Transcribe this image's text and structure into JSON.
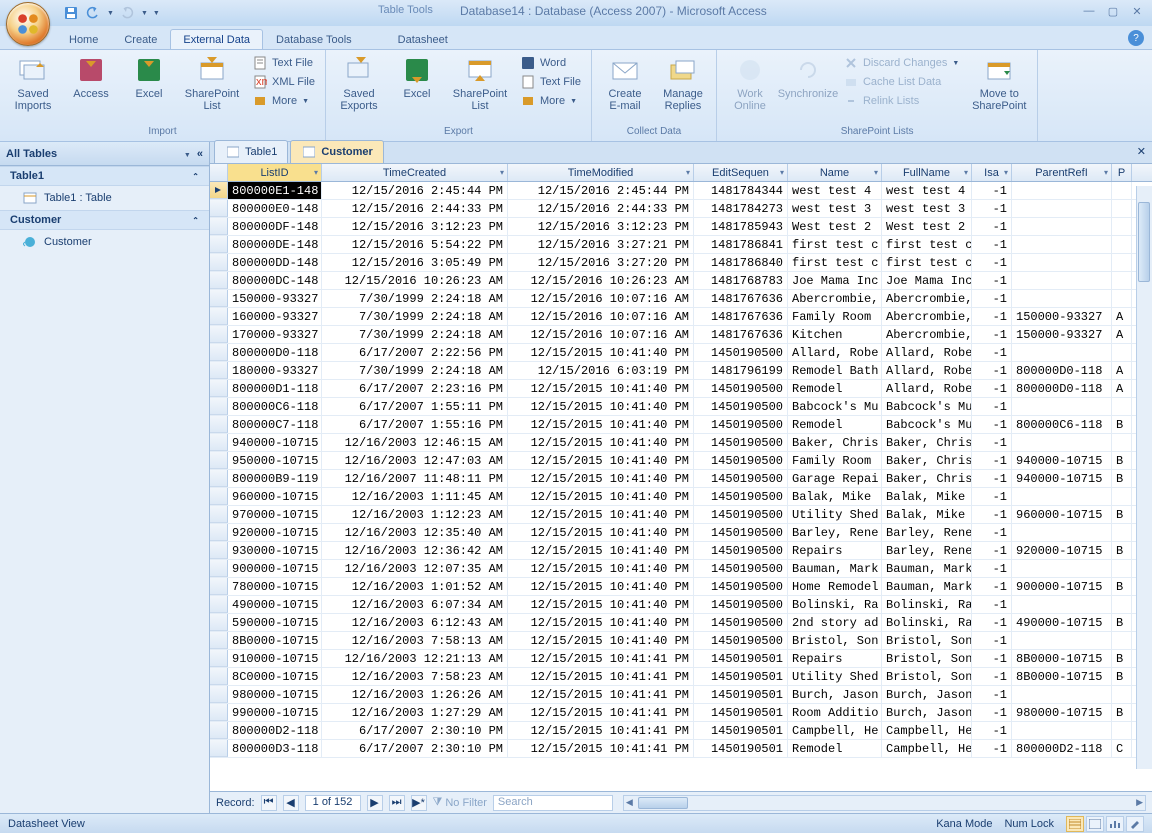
{
  "title_context": "Table Tools",
  "title_main": "Database14 : Database (Access 2007) - Microsoft Access",
  "tabs": [
    "Home",
    "Create",
    "External Data",
    "Database Tools",
    "Datasheet"
  ],
  "active_tab": "External Data",
  "ribbon": {
    "import": {
      "label": "Import",
      "saved_imports": "Saved Imports",
      "access": "Access",
      "excel": "Excel",
      "sp_list": "SharePoint List",
      "text_file": "Text File",
      "xml_file": "XML File",
      "more": "More"
    },
    "export": {
      "label": "Export",
      "saved_exports": "Saved Exports",
      "excel": "Excel",
      "sp_list": "SharePoint List",
      "word": "Word",
      "text_file": "Text File",
      "more": "More"
    },
    "collect": {
      "label": "Collect Data",
      "create_email": "Create E-mail",
      "manage_replies": "Manage Replies"
    },
    "sp": {
      "label": "SharePoint Lists",
      "work_online": "Work Online",
      "synchronize": "Synchronize",
      "discard": "Discard Changes",
      "cache": "Cache List Data",
      "relink": "Relink Lists",
      "move": "Move to SharePoint"
    }
  },
  "nav": {
    "header": "All Tables",
    "groups": [
      {
        "title": "Table1",
        "items": [
          "Table1 : Table"
        ]
      },
      {
        "title": "Customer",
        "items": [
          "Customer"
        ]
      }
    ]
  },
  "doc_tabs": [
    "Table1",
    "Customer"
  ],
  "active_doc": "Customer",
  "columns": [
    "ListID",
    "TimeCreated",
    "TimeModified",
    "EditSequen",
    "Name",
    "FullName",
    "Isa",
    "ParentRefI",
    "P"
  ],
  "rows": [
    [
      "800000E1-148",
      "12/15/2016 2:45:44 PM",
      "12/15/2016 2:45:44 PM",
      "1481784344",
      "west test 4",
      "west test 4",
      "-1",
      "",
      ""
    ],
    [
      "800000E0-148",
      "12/15/2016 2:44:33 PM",
      "12/15/2016 2:44:33 PM",
      "1481784273",
      "west test 3",
      "west test 3",
      "-1",
      "",
      ""
    ],
    [
      "800000DF-148",
      "12/15/2016 3:12:23 PM",
      "12/15/2016 3:12:23 PM",
      "1481785943",
      "West test 2",
      "West test 2",
      "-1",
      "",
      ""
    ],
    [
      "800000DE-148",
      "12/15/2016 5:54:22 PM",
      "12/15/2016 3:27:21 PM",
      "1481786841",
      "first test c",
      "first test c",
      "-1",
      "",
      ""
    ],
    [
      "800000DD-148",
      "12/15/2016 3:05:49 PM",
      "12/15/2016 3:27:20 PM",
      "1481786840",
      "first test c",
      "first test c",
      "-1",
      "",
      ""
    ],
    [
      "800000DC-148",
      "12/15/2016 10:26:23 AM",
      "12/15/2016 10:26:23 AM",
      "1481768783",
      "Joe Mama Inc",
      "Joe Mama Inc",
      "-1",
      "",
      ""
    ],
    [
      "150000-93327",
      "7/30/1999 2:24:18 AM",
      "12/15/2016 10:07:16 AM",
      "1481767636",
      "Abercrombie,",
      "Abercrombie,",
      "-1",
      "",
      ""
    ],
    [
      "160000-93327",
      "7/30/1999 2:24:18 AM",
      "12/15/2016 10:07:16 AM",
      "1481767636",
      "Family Room",
      "Abercrombie,",
      "-1",
      "150000-93327",
      "A"
    ],
    [
      "170000-93327",
      "7/30/1999 2:24:18 AM",
      "12/15/2016 10:07:16 AM",
      "1481767636",
      "Kitchen",
      "Abercrombie,",
      "-1",
      "150000-93327",
      "A"
    ],
    [
      "800000D0-118",
      "6/17/2007 2:22:56 PM",
      "12/15/2015 10:41:40 PM",
      "1450190500",
      "Allard, Robe",
      "Allard, Robe",
      "-1",
      "",
      ""
    ],
    [
      "180000-93327",
      "7/30/1999 2:24:18 AM",
      "12/15/2016 6:03:19 PM",
      "1481796199",
      "Remodel Bath",
      "Allard, Robe",
      "-1",
      "800000D0-118",
      "A"
    ],
    [
      "800000D1-118",
      "6/17/2007 2:23:16 PM",
      "12/15/2015 10:41:40 PM",
      "1450190500",
      "Remodel",
      "Allard, Robe",
      "-1",
      "800000D0-118",
      "A"
    ],
    [
      "800000C6-118",
      "6/17/2007 1:55:11 PM",
      "12/15/2015 10:41:40 PM",
      "1450190500",
      "Babcock's Mu",
      "Babcock's Mu",
      "-1",
      "",
      ""
    ],
    [
      "800000C7-118",
      "6/17/2007 1:55:16 PM",
      "12/15/2015 10:41:40 PM",
      "1450190500",
      "Remodel",
      "Babcock's Mu",
      "-1",
      "800000C6-118",
      "B"
    ],
    [
      "940000-10715",
      "12/16/2003 12:46:15 AM",
      "12/15/2015 10:41:40 PM",
      "1450190500",
      "Baker, Chris",
      "Baker, Chris",
      "-1",
      "",
      ""
    ],
    [
      "950000-10715",
      "12/16/2003 12:47:03 AM",
      "12/15/2015 10:41:40 PM",
      "1450190500",
      "Family Room",
      "Baker, Chris",
      "-1",
      "940000-10715",
      "B"
    ],
    [
      "800000B9-119",
      "12/16/2007 11:48:11 PM",
      "12/15/2015 10:41:40 PM",
      "1450190500",
      "Garage Repai",
      "Baker, Chris",
      "-1",
      "940000-10715",
      "B"
    ],
    [
      "960000-10715",
      "12/16/2003 1:11:45 AM",
      "12/15/2015 10:41:40 PM",
      "1450190500",
      "Balak, Mike",
      "Balak, Mike",
      "-1",
      "",
      ""
    ],
    [
      "970000-10715",
      "12/16/2003 1:12:23 AM",
      "12/15/2015 10:41:40 PM",
      "1450190500",
      "Utility Shed",
      "Balak, Mike",
      "-1",
      "960000-10715",
      "B"
    ],
    [
      "920000-10715",
      "12/16/2003 12:35:40 AM",
      "12/15/2015 10:41:40 PM",
      "1450190500",
      "Barley, Rene",
      "Barley, Rene",
      "-1",
      "",
      ""
    ],
    [
      "930000-10715",
      "12/16/2003 12:36:42 AM",
      "12/15/2015 10:41:40 PM",
      "1450190500",
      "Repairs",
      "Barley, Rene",
      "-1",
      "920000-10715",
      "B"
    ],
    [
      "900000-10715",
      "12/16/2003 12:07:35 AM",
      "12/15/2015 10:41:40 PM",
      "1450190500",
      "Bauman, Mark",
      "Bauman, Mark",
      "-1",
      "",
      ""
    ],
    [
      "780000-10715",
      "12/16/2003 1:01:52 AM",
      "12/15/2015 10:41:40 PM",
      "1450190500",
      "Home Remodel",
      "Bauman, Mark",
      "-1",
      "900000-10715",
      "B"
    ],
    [
      "490000-10715",
      "12/16/2003 6:07:34 AM",
      "12/15/2015 10:41:40 PM",
      "1450190500",
      "Bolinski, Ra",
      "Bolinski, Ra",
      "-1",
      "",
      ""
    ],
    [
      "590000-10715",
      "12/16/2003 6:12:43 AM",
      "12/15/2015 10:41:40 PM",
      "1450190500",
      "2nd story ad",
      "Bolinski, Ra",
      "-1",
      "490000-10715",
      "B"
    ],
    [
      "8B0000-10715",
      "12/16/2003 7:58:13 AM",
      "12/15/2015 10:41:40 PM",
      "1450190500",
      "Bristol, Son",
      "Bristol, Son",
      "-1",
      "",
      ""
    ],
    [
      "910000-10715",
      "12/16/2003 12:21:13 AM",
      "12/15/2015 10:41:41 PM",
      "1450190501",
      "Repairs",
      "Bristol, Son",
      "-1",
      "8B0000-10715",
      "B"
    ],
    [
      "8C0000-10715",
      "12/16/2003 7:58:23 AM",
      "12/15/2015 10:41:41 PM",
      "1450190501",
      "Utility Shed",
      "Bristol, Son",
      "-1",
      "8B0000-10715",
      "B"
    ],
    [
      "980000-10715",
      "12/16/2003 1:26:26 AM",
      "12/15/2015 10:41:41 PM",
      "1450190501",
      "Burch, Jason",
      "Burch, Jason",
      "-1",
      "",
      ""
    ],
    [
      "990000-10715",
      "12/16/2003 1:27:29 AM",
      "12/15/2015 10:41:41 PM",
      "1450190501",
      "Room Additio",
      "Burch, Jason",
      "-1",
      "980000-10715",
      "B"
    ],
    [
      "800000D2-118",
      "6/17/2007 2:30:10 PM",
      "12/15/2015 10:41:41 PM",
      "1450190501",
      "Campbell, He",
      "Campbell, He",
      "-1",
      "",
      ""
    ],
    [
      "800000D3-118",
      "6/17/2007 2:30:10 PM",
      "12/15/2015 10:41:41 PM",
      "1450190501",
      "Remodel",
      "Campbell, He",
      "-1",
      "800000D2-118",
      "C"
    ]
  ],
  "record_nav": {
    "label": "Record:",
    "pos": "1 of 152",
    "no_filter": "No Filter",
    "search": "Search"
  },
  "status": {
    "left": "Datasheet View",
    "kana": "Kana Mode",
    "numlock": "Num Lock"
  }
}
